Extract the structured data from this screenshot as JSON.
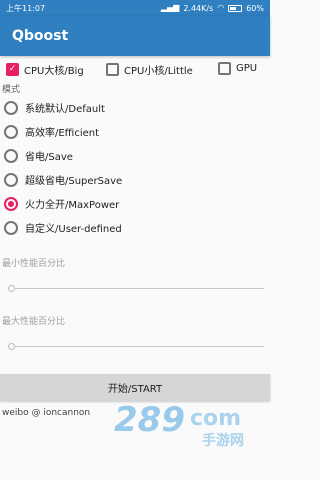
{
  "status_bar": {
    "time": "上午11:07",
    "net_speed": "2.44K/s",
    "battery": "60%",
    "battery_level": 0.6,
    "icons": [
      "signal-icon",
      "wifi-icon",
      "battery-icon"
    ]
  },
  "app": {
    "title": "Qboost"
  },
  "cores": [
    {
      "label": "CPU大核/Big",
      "checked": true
    },
    {
      "label": "CPU小核/Little",
      "checked": false
    },
    {
      "label": "GPU",
      "checked": false
    }
  ],
  "mode": {
    "heading": "模式",
    "options": [
      {
        "label": "系统默认/Default",
        "selected": false
      },
      {
        "label": "高效率/Efficient",
        "selected": false
      },
      {
        "label": "省电/Save",
        "selected": false
      },
      {
        "label": "超级省电/SuperSave",
        "selected": false
      },
      {
        "label": "火力全开/MaxPower",
        "selected": true
      },
      {
        "label": "自定义/User-defined",
        "selected": false
      }
    ]
  },
  "min_perf": {
    "label": "最小性能百分比",
    "value": 0
  },
  "max_perf": {
    "label": "最大性能百分比",
    "value": 0
  },
  "start_button": {
    "label": "开始/START"
  },
  "credit": "weibo @ ioncannon",
  "watermark": {
    "text": "289",
    "suffix": "com",
    "sub": "手游网"
  },
  "colors": {
    "primary": "#2f7fc1",
    "accent": "#e91e63",
    "button": "#d6d6d6"
  }
}
